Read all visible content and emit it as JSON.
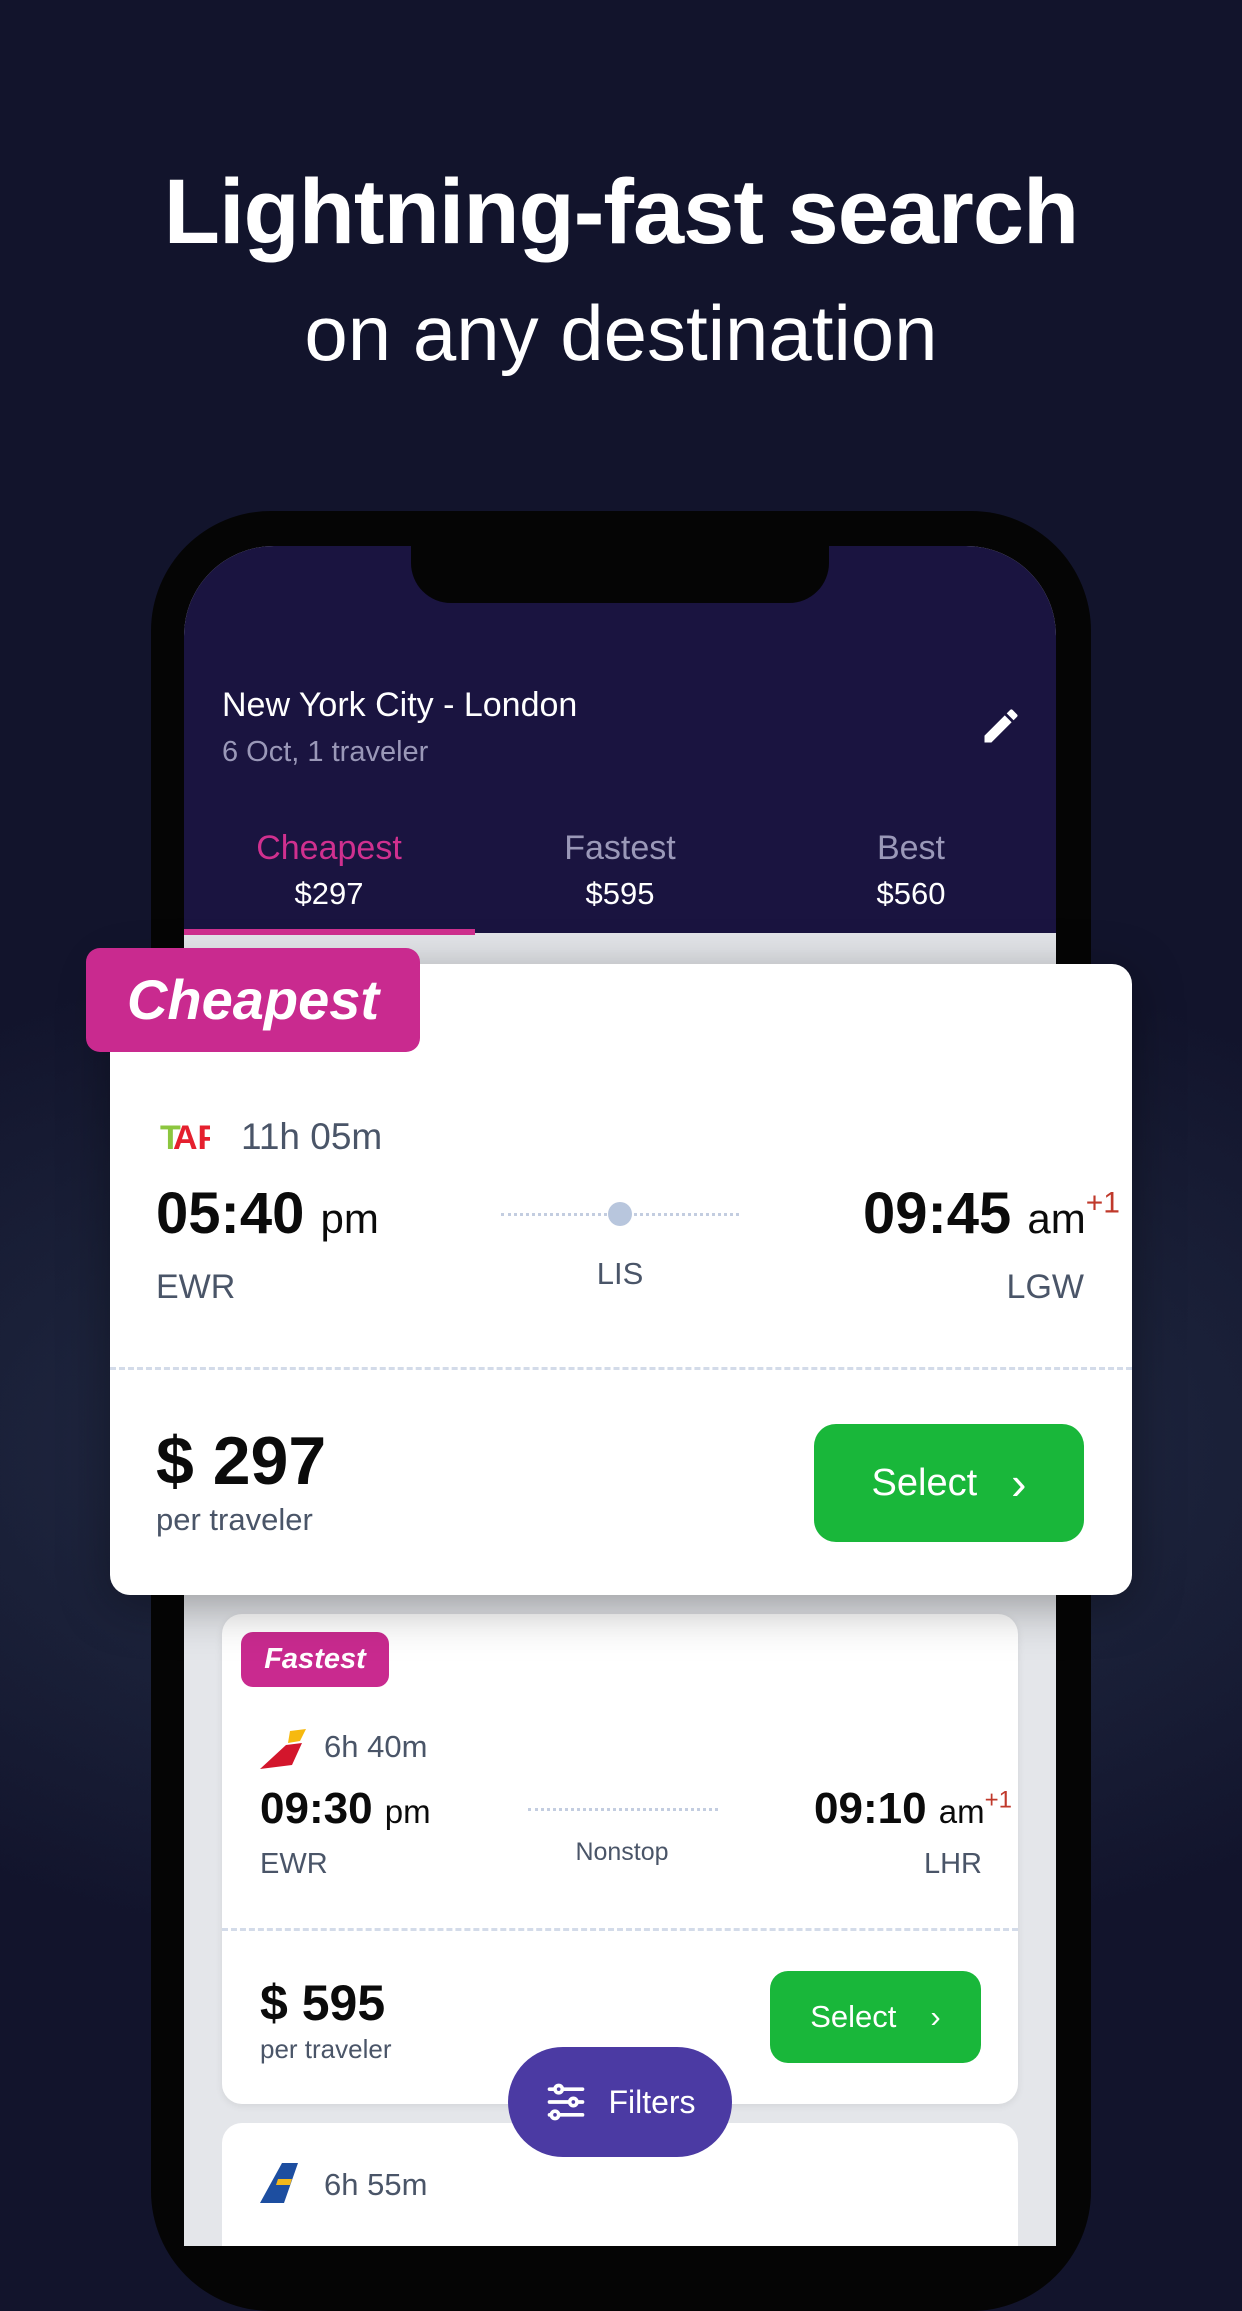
{
  "headline": {
    "line1": "Lightning-fast search",
    "line2": "on any destination"
  },
  "header": {
    "route": "New York City - London",
    "details": "6 Oct, 1 traveler",
    "edit_icon": "pencil-icon"
  },
  "tabs": [
    {
      "label": "Cheapest",
      "price": "$297",
      "active": true
    },
    {
      "label": "Fastest",
      "price": "$595"
    },
    {
      "label": "Best",
      "price": "$560"
    }
  ],
  "colors": {
    "accent": "#c92a8f",
    "select": "#19b73a",
    "filters": "#4b3aa3",
    "header": "#1a1440"
  },
  "flights": [
    {
      "badge": "Cheapest",
      "airline_logo": "TAP",
      "duration": "11h 05m",
      "dep_time": "05:40",
      "dep_ampm": "pm",
      "arr_time": "09:45",
      "arr_ampm": "am",
      "day_offset": "+1",
      "from": "EWR",
      "stop": "LIS",
      "to": "LGW",
      "price": "$ 297",
      "per": "per traveler",
      "select": "Select"
    },
    {
      "badge": "Fastest",
      "airline_logo": "Iberia",
      "duration": "6h 40m",
      "dep_time": "09:30",
      "dep_ampm": "pm",
      "arr_time": "09:10",
      "arr_ampm": "am",
      "day_offset": "+1",
      "from": "EWR",
      "stop": "Nonstop",
      "to": "LHR",
      "price": "$ 595",
      "per": "per traveler",
      "select": "Select"
    },
    {
      "airline_logo": "Icelandair",
      "duration": "6h 55m"
    }
  ],
  "filters_label": "Filters"
}
